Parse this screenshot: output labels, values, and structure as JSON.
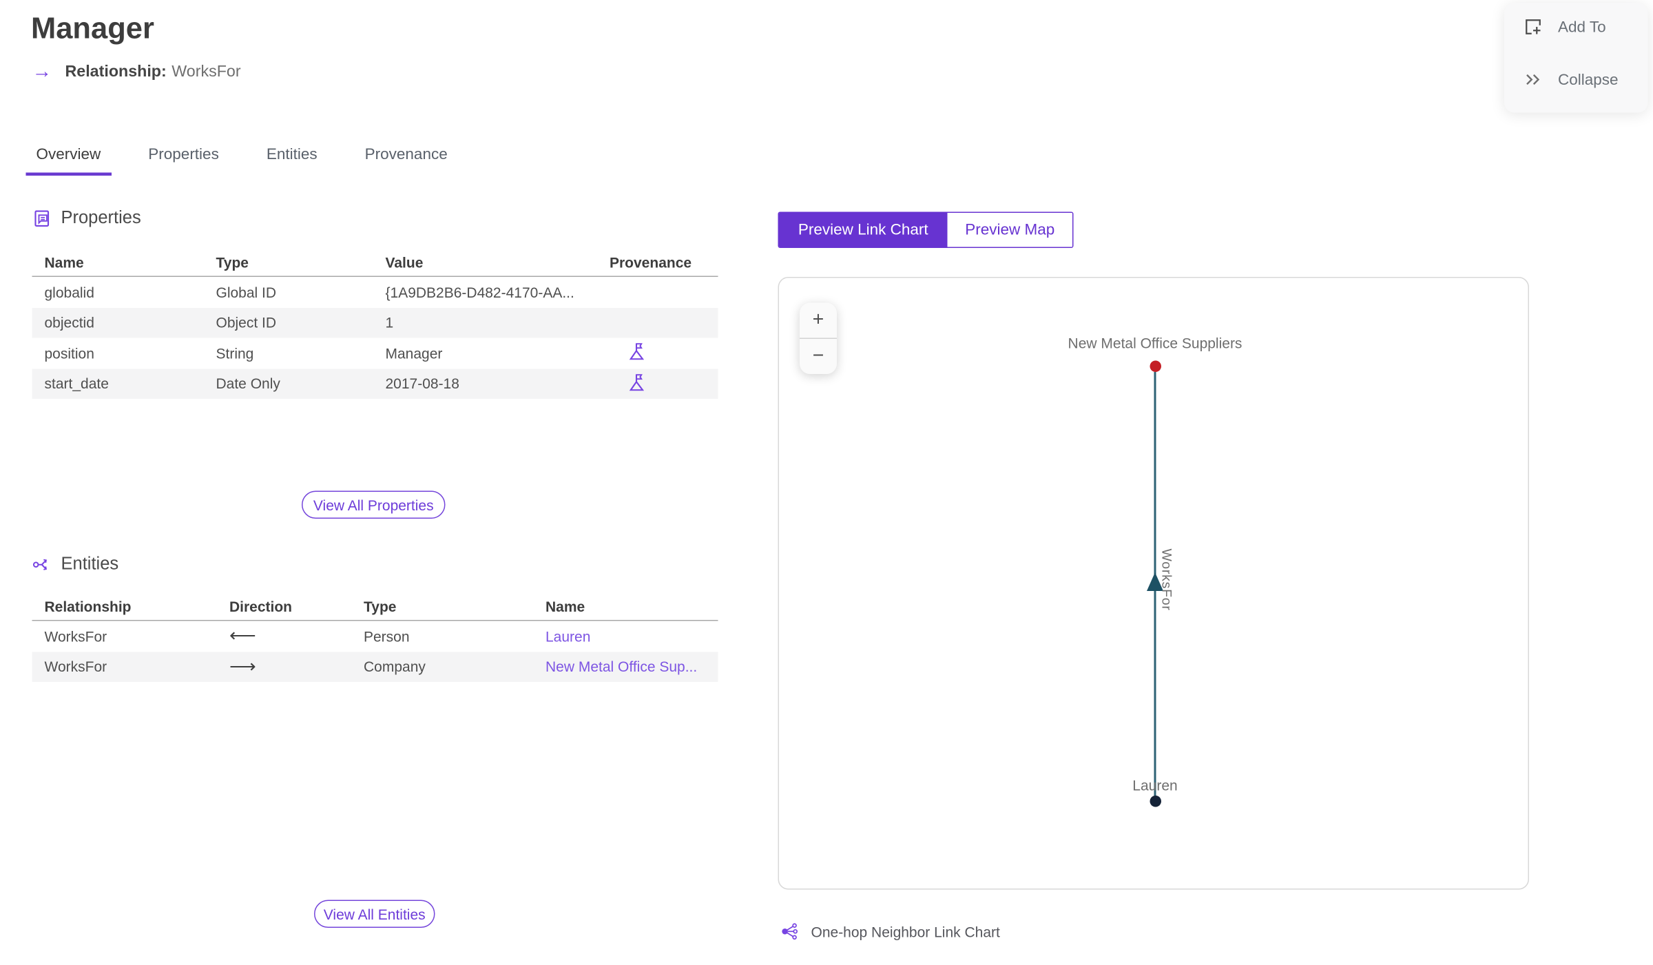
{
  "page": {
    "title": "Manager",
    "relationship_arrow": "→",
    "relationship_label": "Relationship:",
    "relationship_value": "WorksFor"
  },
  "actions": {
    "add_to": "Add To",
    "collapse": "Collapse"
  },
  "tabs": [
    {
      "label": "Overview",
      "active": true
    },
    {
      "label": "Properties",
      "active": false
    },
    {
      "label": "Entities",
      "active": false
    },
    {
      "label": "Provenance",
      "active": false
    }
  ],
  "properties_section": {
    "heading": "Properties",
    "columns": [
      "Name",
      "Type",
      "Value",
      "Provenance"
    ],
    "rows": [
      {
        "name": "globalid",
        "type": "Global ID",
        "value": "{1A9DB2B6-D482-4170-AA...",
        "has_provenance": false
      },
      {
        "name": "objectid",
        "type": "Object ID",
        "value": "1",
        "has_provenance": false
      },
      {
        "name": "position",
        "type": "String",
        "value": "Manager",
        "has_provenance": true
      },
      {
        "name": "start_date",
        "type": "Date Only",
        "value": "2017-08-18",
        "has_provenance": true
      }
    ],
    "view_all_label": "View All Properties"
  },
  "entities_section": {
    "heading": "Entities",
    "columns": [
      "Relationship",
      "Direction",
      "Type",
      "Name"
    ],
    "rows": [
      {
        "relationship": "WorksFor",
        "direction_glyph": "⟵",
        "type": "Person",
        "name": "Lauren"
      },
      {
        "relationship": "WorksFor",
        "direction_glyph": "⟶",
        "type": "Company",
        "name": "New Metal Office Sup..."
      }
    ],
    "view_all_label": "View All Entities"
  },
  "preview": {
    "link_chart_label": "Preview Link Chart",
    "map_label": "Preview Map",
    "zoom_in": "+",
    "zoom_out": "−",
    "caption": "One-hop Neighbor Link Chart"
  },
  "link_chart": {
    "nodes": [
      {
        "label": "New Metal Office Suppliers",
        "color": "#c41e25"
      },
      {
        "label": "Lauren",
        "color": "#152338"
      }
    ],
    "edge": {
      "label": "WorksFor",
      "color": "#2d6274",
      "from": "Lauren",
      "to": "New Metal Office Suppliers"
    }
  },
  "colors": {
    "accent_purple": "#6733d1",
    "link_purple": "#7d55e3",
    "icon_purple": "#7743e2",
    "edge_teal": "#2d6274",
    "node_red": "#c41e25",
    "node_navy": "#152338",
    "alt_row": "#f4f4f5"
  }
}
